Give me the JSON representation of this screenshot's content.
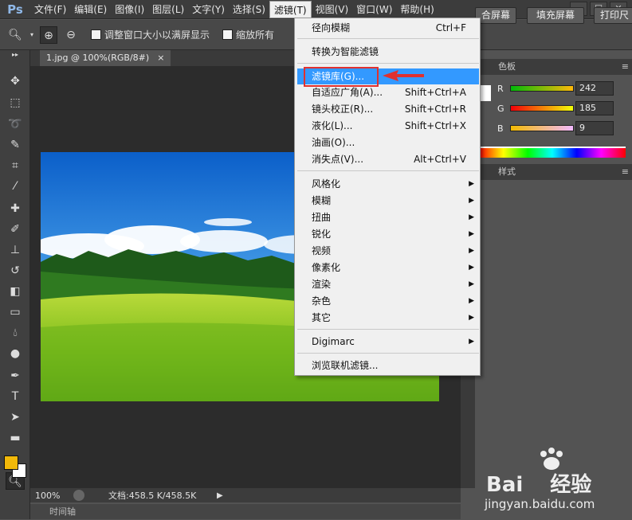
{
  "app": {
    "logo": "Ps"
  },
  "menubar": {
    "items": [
      "文件(F)",
      "编辑(E)",
      "图像(I)",
      "图层(L)",
      "文字(Y)",
      "选择(S)",
      "滤镜(T)",
      "视图(V)",
      "窗口(W)",
      "帮助(H)"
    ],
    "active_index": 6
  },
  "window_controls": {
    "minimize": "—",
    "maximize": "☐",
    "close": "✕"
  },
  "options": {
    "resize_windows_label": "调整窗口大小以满屏显示",
    "zoom_all_label": "缩放所有",
    "fit_screen_label": "合屏幕",
    "fill_screen_label": "填充屏幕",
    "print_size_label": "打印尺"
  },
  "document": {
    "tab_title": "1.jpg @ 100%(RGB/8#)",
    "close": "×",
    "zoom": "100%",
    "doc_size": "文档:458.5 K/458.5K",
    "timeline_label": "时间轴"
  },
  "filter_menu": {
    "items": [
      {
        "label": "径向模糊",
        "shortcut": "Ctrl+F"
      },
      {
        "label": "转换为智能滤镜",
        "shortcut": ""
      },
      {
        "label": "滤镜库(G)...",
        "shortcut": ""
      },
      {
        "label": "自适应广角(A)...",
        "shortcut": "Shift+Ctrl+A"
      },
      {
        "label": "镜头校正(R)...",
        "shortcut": "Shift+Ctrl+R"
      },
      {
        "label": "液化(L)...",
        "shortcut": "Shift+Ctrl+X"
      },
      {
        "label": "油画(O)...",
        "shortcut": ""
      },
      {
        "label": "消失点(V)...",
        "shortcut": "Alt+Ctrl+V"
      },
      {
        "label": "风格化",
        "shortcut": ""
      },
      {
        "label": "模糊",
        "shortcut": ""
      },
      {
        "label": "扭曲",
        "shortcut": ""
      },
      {
        "label": "锐化",
        "shortcut": ""
      },
      {
        "label": "视频",
        "shortcut": ""
      },
      {
        "label": "像素化",
        "shortcut": ""
      },
      {
        "label": "渲染",
        "shortcut": ""
      },
      {
        "label": "杂色",
        "shortcut": ""
      },
      {
        "label": "其它",
        "shortcut": ""
      },
      {
        "label": "Digimarc",
        "shortcut": ""
      },
      {
        "label": "浏览联机滤镜...",
        "shortcut": ""
      }
    ],
    "hover_index": 2
  },
  "color_panel": {
    "tab_label": "色板",
    "r_label": "R",
    "r_value": "242",
    "g_label": "G",
    "g_value": "185",
    "b_label": "B",
    "b_value": "9"
  },
  "style_panel": {
    "tab_label": "样式"
  },
  "colors": {
    "foreground": "#f2b909",
    "background": "#ffffff",
    "menu_highlight": "#3399ff",
    "annotation_red": "#e0312f"
  },
  "watermark": {
    "brand_latin": "Bai",
    "brand_cn": "经验",
    "url": "jingyan.baidu.com"
  }
}
